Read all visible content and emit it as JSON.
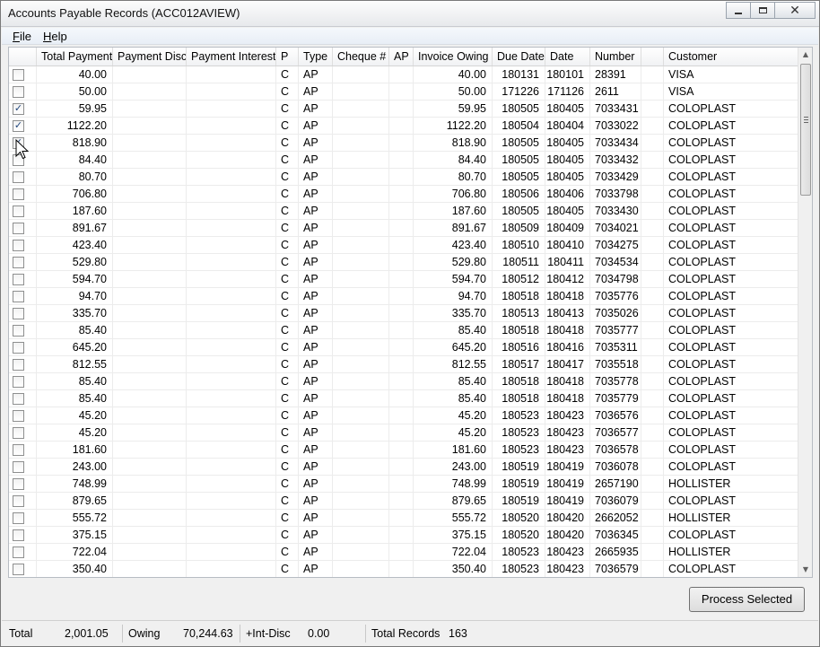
{
  "window": {
    "title": "Accounts Payable Records (ACC012AVIEW)",
    "controls": {
      "close": "✕"
    }
  },
  "menu": {
    "file": {
      "ul": "F",
      "rest": "ile"
    },
    "help": {
      "ul": "H",
      "rest": "elp"
    }
  },
  "table": {
    "columns": [
      "",
      "Total Payment",
      "Payment Disc",
      "Payment Interest",
      "P",
      "Type",
      "Cheque #",
      "AP",
      "Invoice Owing",
      "Due Date",
      "Date",
      "Number",
      "",
      "Customer"
    ],
    "rows": [
      {
        "checked": false,
        "total": "40.00",
        "p": "C",
        "type": "AP",
        "owing": "40.00",
        "due": "180131",
        "date": "180101",
        "number": "28391",
        "customer": "VISA"
      },
      {
        "checked": false,
        "total": "50.00",
        "p": "C",
        "type": "AP",
        "owing": "50.00",
        "due": "171226",
        "date": "171126",
        "number": "2611",
        "customer": "VISA"
      },
      {
        "checked": true,
        "total": "59.95",
        "p": "C",
        "type": "AP",
        "owing": "59.95",
        "due": "180505",
        "date": "180405",
        "number": "7033431",
        "customer": "COLOPLAST"
      },
      {
        "checked": true,
        "total": "1122.20",
        "p": "C",
        "type": "AP",
        "owing": "1122.20",
        "due": "180504",
        "date": "180404",
        "number": "7033022",
        "customer": "COLOPLAST"
      },
      {
        "checked": true,
        "total": "818.90",
        "p": "C",
        "type": "AP",
        "owing": "818.90",
        "due": "180505",
        "date": "180405",
        "number": "7033434",
        "customer": "COLOPLAST"
      },
      {
        "checked": false,
        "total": "84.40",
        "p": "C",
        "type": "AP",
        "owing": "84.40",
        "due": "180505",
        "date": "180405",
        "number": "7033432",
        "customer": "COLOPLAST"
      },
      {
        "checked": false,
        "total": "80.70",
        "p": "C",
        "type": "AP",
        "owing": "80.70",
        "due": "180505",
        "date": "180405",
        "number": "7033429",
        "customer": "COLOPLAST"
      },
      {
        "checked": false,
        "total": "706.80",
        "p": "C",
        "type": "AP",
        "owing": "706.80",
        "due": "180506",
        "date": "180406",
        "number": "7033798",
        "customer": "COLOPLAST"
      },
      {
        "checked": false,
        "total": "187.60",
        "p": "C",
        "type": "AP",
        "owing": "187.60",
        "due": "180505",
        "date": "180405",
        "number": "7033430",
        "customer": "COLOPLAST"
      },
      {
        "checked": false,
        "total": "891.67",
        "p": "C",
        "type": "AP",
        "owing": "891.67",
        "due": "180509",
        "date": "180409",
        "number": "7034021",
        "customer": "COLOPLAST"
      },
      {
        "checked": false,
        "total": "423.40",
        "p": "C",
        "type": "AP",
        "owing": "423.40",
        "due": "180510",
        "date": "180410",
        "number": "7034275",
        "customer": "COLOPLAST"
      },
      {
        "checked": false,
        "total": "529.80",
        "p": "C",
        "type": "AP",
        "owing": "529.80",
        "due": "180511",
        "date": "180411",
        "number": "7034534",
        "customer": "COLOPLAST"
      },
      {
        "checked": false,
        "total": "594.70",
        "p": "C",
        "type": "AP",
        "owing": "594.70",
        "due": "180512",
        "date": "180412",
        "number": "7034798",
        "customer": "COLOPLAST"
      },
      {
        "checked": false,
        "total": "94.70",
        "p": "C",
        "type": "AP",
        "owing": "94.70",
        "due": "180518",
        "date": "180418",
        "number": "7035776",
        "customer": "COLOPLAST"
      },
      {
        "checked": false,
        "total": "335.70",
        "p": "C",
        "type": "AP",
        "owing": "335.70",
        "due": "180513",
        "date": "180413",
        "number": "7035026",
        "customer": "COLOPLAST"
      },
      {
        "checked": false,
        "total": "85.40",
        "p": "C",
        "type": "AP",
        "owing": "85.40",
        "due": "180518",
        "date": "180418",
        "number": "7035777",
        "customer": "COLOPLAST"
      },
      {
        "checked": false,
        "total": "645.20",
        "p": "C",
        "type": "AP",
        "owing": "645.20",
        "due": "180516",
        "date": "180416",
        "number": "7035311",
        "customer": "COLOPLAST"
      },
      {
        "checked": false,
        "total": "812.55",
        "p": "C",
        "type": "AP",
        "owing": "812.55",
        "due": "180517",
        "date": "180417",
        "number": "7035518",
        "customer": "COLOPLAST"
      },
      {
        "checked": false,
        "total": "85.40",
        "p": "C",
        "type": "AP",
        "owing": "85.40",
        "due": "180518",
        "date": "180418",
        "number": "7035778",
        "customer": "COLOPLAST"
      },
      {
        "checked": false,
        "total": "85.40",
        "p": "C",
        "type": "AP",
        "owing": "85.40",
        "due": "180518",
        "date": "180418",
        "number": "7035779",
        "customer": "COLOPLAST"
      },
      {
        "checked": false,
        "total": "45.20",
        "p": "C",
        "type": "AP",
        "owing": "45.20",
        "due": "180523",
        "date": "180423",
        "number": "7036576",
        "customer": "COLOPLAST"
      },
      {
        "checked": false,
        "total": "45.20",
        "p": "C",
        "type": "AP",
        "owing": "45.20",
        "due": "180523",
        "date": "180423",
        "number": "7036577",
        "customer": "COLOPLAST"
      },
      {
        "checked": false,
        "total": "181.60",
        "p": "C",
        "type": "AP",
        "owing": "181.60",
        "due": "180523",
        "date": "180423",
        "number": "7036578",
        "customer": "COLOPLAST"
      },
      {
        "checked": false,
        "total": "243.00",
        "p": "C",
        "type": "AP",
        "owing": "243.00",
        "due": "180519",
        "date": "180419",
        "number": "7036078",
        "customer": "COLOPLAST"
      },
      {
        "checked": false,
        "total": "748.99",
        "p": "C",
        "type": "AP",
        "owing": "748.99",
        "due": "180519",
        "date": "180419",
        "number": "2657190",
        "customer": "HOLLISTER"
      },
      {
        "checked": false,
        "total": "879.65",
        "p": "C",
        "type": "AP",
        "owing": "879.65",
        "due": "180519",
        "date": "180419",
        "number": "7036079",
        "customer": "COLOPLAST"
      },
      {
        "checked": false,
        "total": "555.72",
        "p": "C",
        "type": "AP",
        "owing": "555.72",
        "due": "180520",
        "date": "180420",
        "number": "2662052",
        "customer": "HOLLISTER"
      },
      {
        "checked": false,
        "total": "375.15",
        "p": "C",
        "type": "AP",
        "owing": "375.15",
        "due": "180520",
        "date": "180420",
        "number": "7036345",
        "customer": "COLOPLAST"
      },
      {
        "checked": false,
        "total": "722.04",
        "p": "C",
        "type": "AP",
        "owing": "722.04",
        "due": "180523",
        "date": "180423",
        "number": "2665935",
        "customer": "HOLLISTER"
      },
      {
        "checked": false,
        "total": "350.40",
        "p": "C",
        "type": "AP",
        "owing": "350.40",
        "due": "180523",
        "date": "180423",
        "number": "7036579",
        "customer": "COLOPLAST"
      }
    ]
  },
  "actions": {
    "process_selected": "Process Selected"
  },
  "status": {
    "total_label": "Total",
    "total_value": "2,001.05",
    "owing_label": "Owing",
    "owing_value": "70,244.63",
    "int_disc_label": "+Int-Disc",
    "int_disc_value": "0.00",
    "records_label": "Total Records",
    "records_value": "163"
  }
}
